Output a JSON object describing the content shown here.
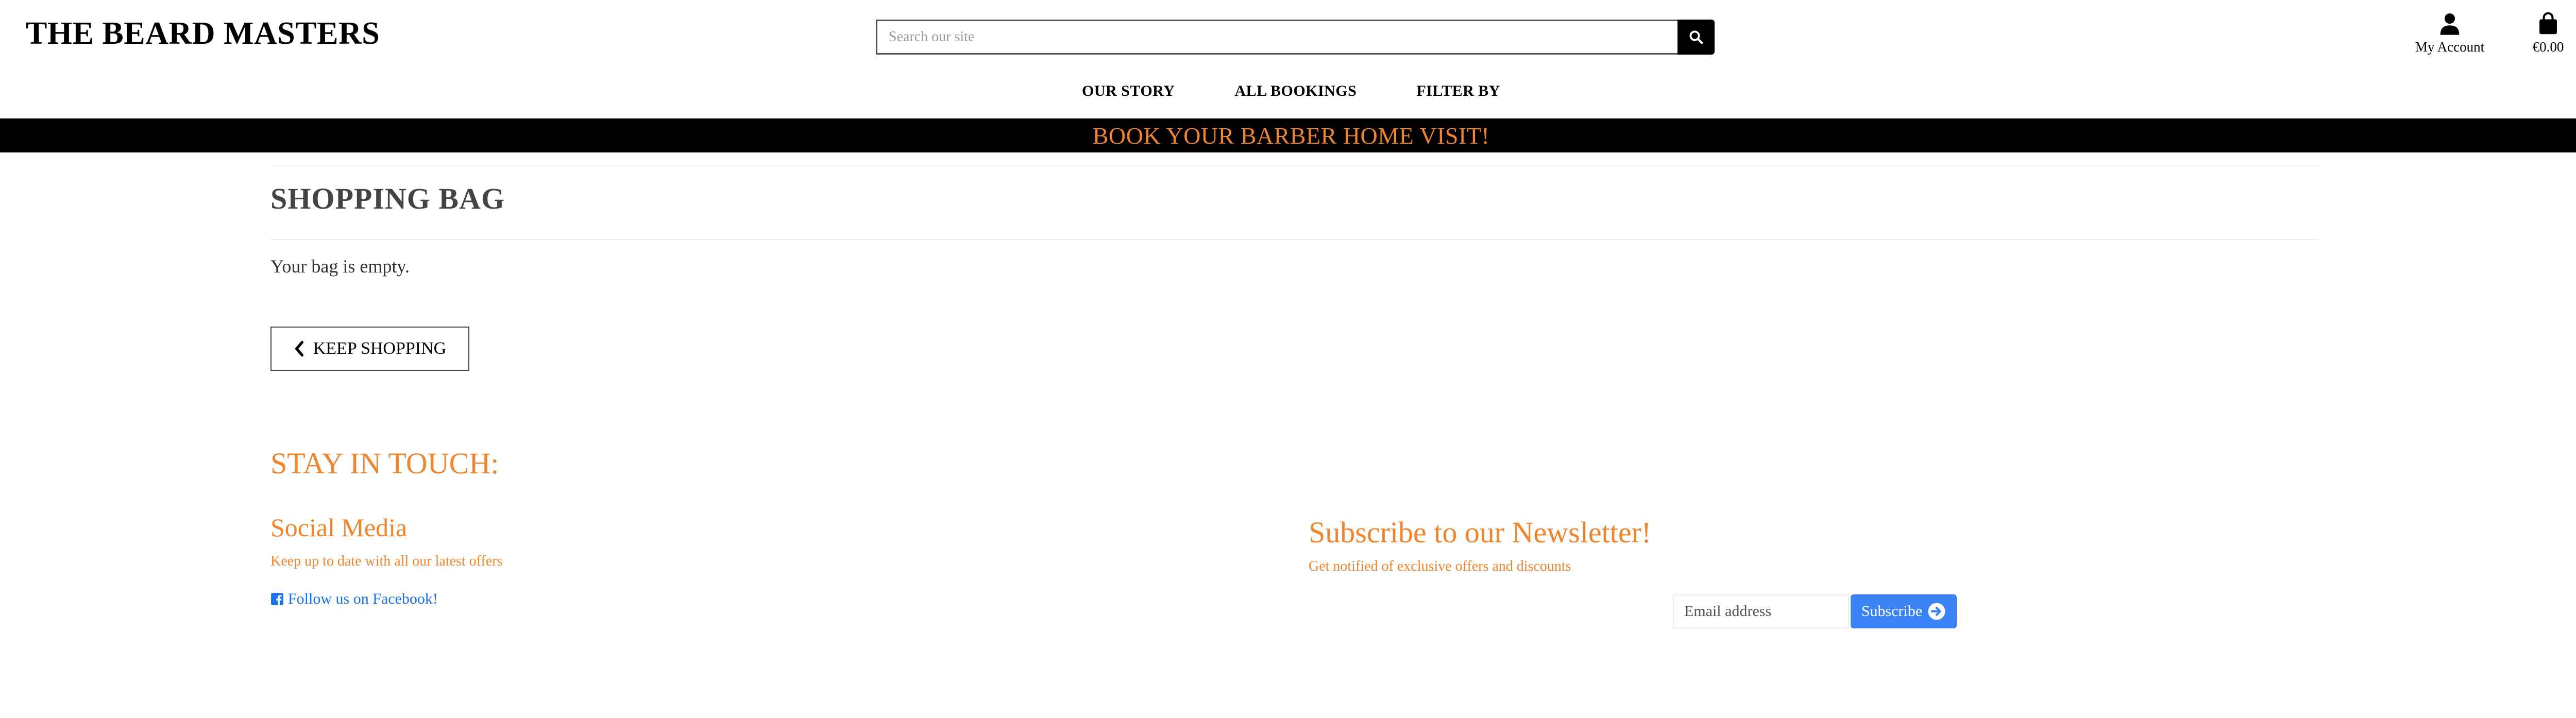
{
  "header": {
    "logo": "THE BEARD MASTERS",
    "search_placeholder": "Search our site",
    "account_label": "My Account",
    "bag_total": "€0.00"
  },
  "nav": {
    "items": [
      "OUR STORY",
      "ALL BOOKINGS",
      "FILTER BY"
    ]
  },
  "banner": {
    "text": "BOOK YOUR BARBER HOME VISIT!"
  },
  "main": {
    "title": "SHOPPING BAG",
    "empty_message": "Your bag is empty.",
    "keep_shopping_label": "KEEP SHOPPING"
  },
  "footer": {
    "stay_heading": "STAY IN TOUCH:",
    "social_heading": "Social Media",
    "social_text": "Keep up to date with all our latest offers",
    "facebook_link": "Follow us on Facebook!",
    "newsletter_heading": "Subscribe to our Newsletter!",
    "newsletter_text": "Get notified of exclusive offers and discounts",
    "email_placeholder": "Email address",
    "subscribe_label": "Subscribe"
  },
  "colors": {
    "accent_orange": "#f0852d",
    "banner_bg": "#000000",
    "link_blue": "#1a73e8",
    "button_blue": "#3b82f6"
  },
  "icons": {
    "search": "search-icon",
    "account": "user-icon",
    "bag": "shopping-bag-icon",
    "back": "chevron-left-icon",
    "facebook": "facebook-icon",
    "subscribe": "arrow-circle-right-icon"
  }
}
